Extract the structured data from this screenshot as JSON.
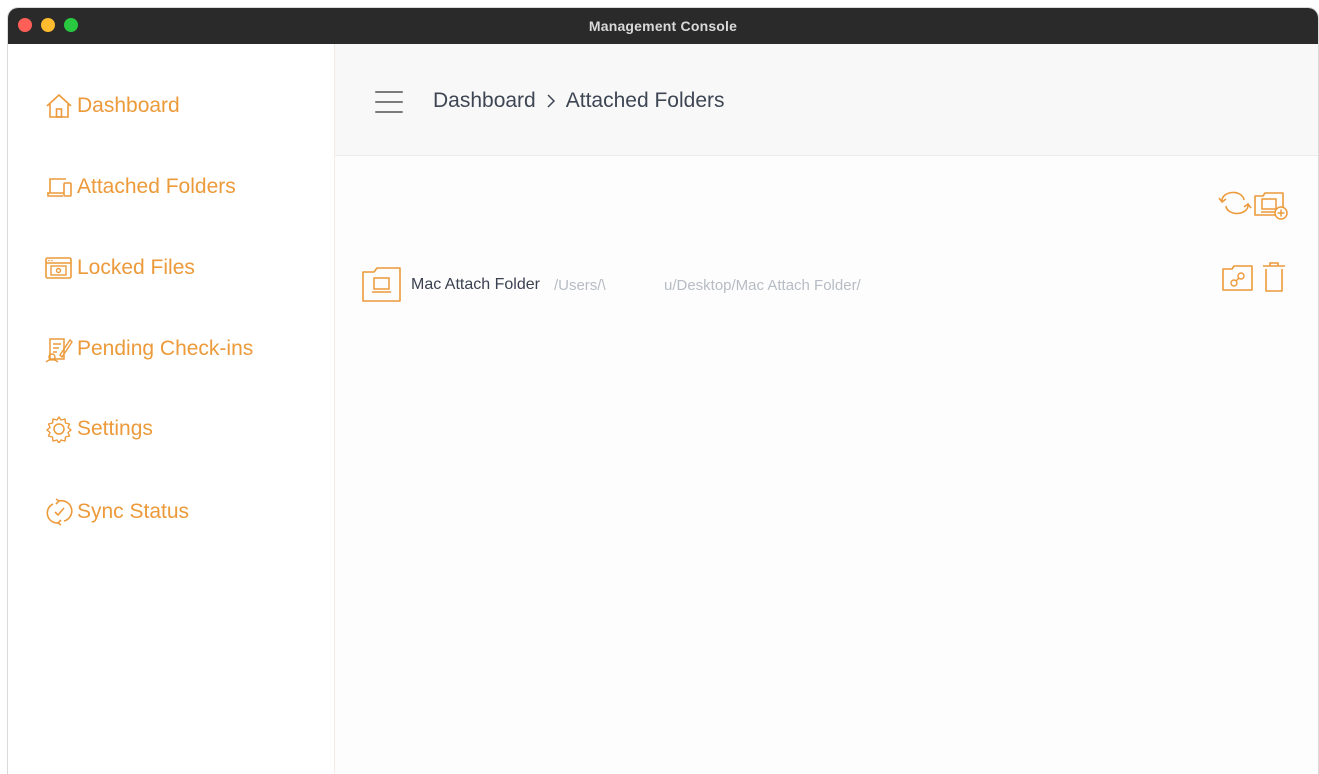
{
  "window": {
    "title": "Management Console"
  },
  "sidebar": {
    "items": [
      {
        "label": "Dashboard",
        "icon": "home-icon"
      },
      {
        "label": "Attached Folders",
        "icon": "folder-device-icon"
      },
      {
        "label": "Locked Files",
        "icon": "locked-file-icon"
      },
      {
        "label": "Pending Check-ins",
        "icon": "pending-checkin-icon"
      },
      {
        "label": "Settings",
        "icon": "gear-icon"
      },
      {
        "label": "Sync Status",
        "icon": "sync-icon"
      }
    ]
  },
  "header": {
    "breadcrumb": [
      "Dashboard",
      "Attached Folders"
    ]
  },
  "toolbar": {
    "refresh_icon": "refresh-icon",
    "add_folder_icon": "add-folder-icon"
  },
  "folders": [
    {
      "name": "Mac Attach Folder",
      "path": "/Users/\\              u/Desktop/Mac Attach Folder/",
      "actions": [
        "folder-link-icon",
        "trash-icon"
      ]
    }
  ],
  "colors": {
    "accent": "#ec9a3a",
    "titlebar": "#2a2a2a",
    "text": "#3e4654"
  }
}
